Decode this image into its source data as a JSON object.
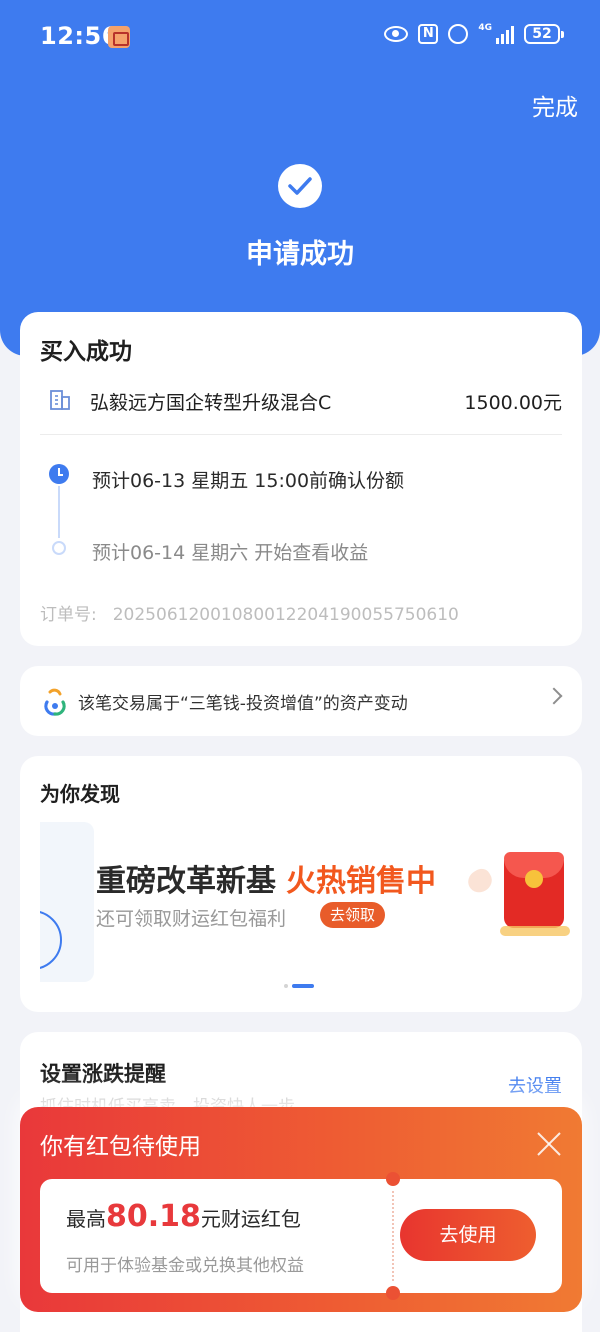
{
  "status_bar": {
    "time": "12:56",
    "network": "4G",
    "battery": "52"
  },
  "header": {
    "done_label": "完成",
    "title": "申请成功"
  },
  "purchase": {
    "title": "买入成功",
    "fund_name": "弘毅远方国企转型升级混合C",
    "amount": "1500.00元",
    "step1": "预计06-13 星期五 15:00前确认份额",
    "step2": "预计06-14 星期六 开始查看收益",
    "order_label": "订单号:",
    "order_no": "20250612001080012204190055750610"
  },
  "asset_link": {
    "text": "该笔交易属于“三笔钱-投资增值”的资产变动"
  },
  "discover": {
    "title": "为你发现",
    "banner_title": "重磅改革新基",
    "banner_hot": "火热销售中",
    "banner_sub": "还可领取财运红包福利",
    "banner_button": "去领取"
  },
  "alert": {
    "title": "设置涨跌提醒",
    "subtitle": "抓住时机低买高卖，投资快人一步",
    "link": "去设置"
  },
  "popup": {
    "title": "你有红包待使用",
    "prefix": "最高",
    "amount": "80.18",
    "suffix": "元财运红包",
    "description": "可用于体验基金或兑换其他权益",
    "button": "去使用"
  },
  "colors": {
    "primary": "#3e7bef",
    "accent": "#f2581e",
    "popup_red": "#e9383a"
  }
}
